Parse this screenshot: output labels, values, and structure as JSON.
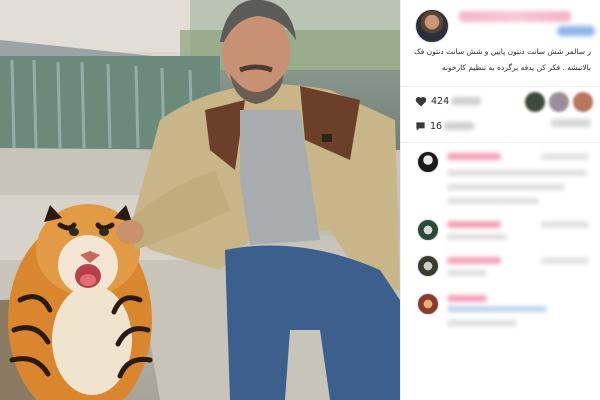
{
  "post": {
    "caption": "ر سالمر شش سانت دنتون پایین و شش سانت دنتون فک بالاتبشه . فکر کن یدفه برگرده به تنظیم کارخونه",
    "likes_prefix": "424",
    "comments_prefix": "16"
  },
  "icons": {
    "heart": "heart-icon",
    "comment": "comment-icon"
  },
  "colors": {
    "username_blur": "#f4b6c8",
    "badge_blur": "#7aa6e8",
    "divider": "#efefef",
    "text": "#262626"
  }
}
